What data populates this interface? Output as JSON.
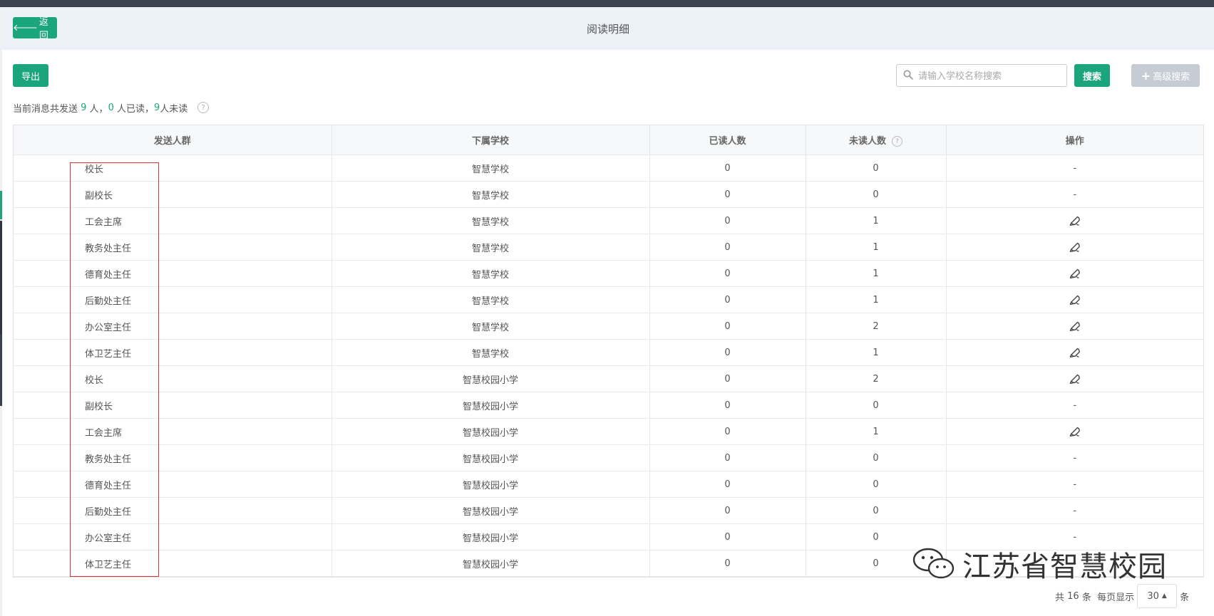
{
  "header": {
    "back_label": "返回",
    "title": "阅读明细"
  },
  "toolbar": {
    "export_label": "导出",
    "search_placeholder": "请输入学校名称搜索",
    "search_label": "搜索",
    "advanced_label": "高级搜索"
  },
  "summary": {
    "p1": "当前消息共发送 ",
    "sent": "9",
    "p2": " 人，",
    "read": "0",
    "p3": " 人已读，",
    "unread": "9",
    "p4": "人未读"
  },
  "table": {
    "headers": [
      "发送人群",
      "下属学校",
      "已读人数",
      "未读人数",
      "操作"
    ],
    "rows": [
      {
        "group": "校长",
        "school": "智慧学校",
        "read": "0",
        "unread": "0",
        "action": "-"
      },
      {
        "group": "副校长",
        "school": "智慧学校",
        "read": "0",
        "unread": "0",
        "action": "-"
      },
      {
        "group": "工会主席",
        "school": "智慧学校",
        "read": "0",
        "unread": "1",
        "action": "bell-icon"
      },
      {
        "group": "教务处主任",
        "school": "智慧学校",
        "read": "0",
        "unread": "1",
        "action": "bell-icon"
      },
      {
        "group": "德育处主任",
        "school": "智慧学校",
        "read": "0",
        "unread": "1",
        "action": "bell-icon"
      },
      {
        "group": "后勤处主任",
        "school": "智慧学校",
        "read": "0",
        "unread": "1",
        "action": "bell-icon"
      },
      {
        "group": "办公室主任",
        "school": "智慧学校",
        "read": "0",
        "unread": "2",
        "action": "bell-icon"
      },
      {
        "group": "体卫艺主任",
        "school": "智慧学校",
        "read": "0",
        "unread": "1",
        "action": "bell-icon"
      },
      {
        "group": "校长",
        "school": "智慧校园小学",
        "read": "0",
        "unread": "2",
        "action": "bell-icon"
      },
      {
        "group": "副校长",
        "school": "智慧校园小学",
        "read": "0",
        "unread": "0",
        "action": "-"
      },
      {
        "group": "工会主席",
        "school": "智慧校园小学",
        "read": "0",
        "unread": "1",
        "action": "bell-icon"
      },
      {
        "group": "教务处主任",
        "school": "智慧校园小学",
        "read": "0",
        "unread": "0",
        "action": "-"
      },
      {
        "group": "德育处主任",
        "school": "智慧校园小学",
        "read": "0",
        "unread": "0",
        "action": "-"
      },
      {
        "group": "后勤处主任",
        "school": "智慧校园小学",
        "read": "0",
        "unread": "0",
        "action": "-"
      },
      {
        "group": "办公室主任",
        "school": "智慧校园小学",
        "read": "0",
        "unread": "0",
        "action": "-"
      },
      {
        "group": "体卫艺主任",
        "school": "智慧校园小学",
        "read": "0",
        "unread": "0",
        "action": "-"
      }
    ]
  },
  "pagination": {
    "total_prefix": "共 ",
    "total": "16",
    "total_suffix": " 条  每页显示",
    "page_size": "30",
    "unit": "条"
  },
  "watermark": {
    "text": "江苏省智慧校园"
  },
  "colors": {
    "accent": "#1aa57c",
    "header_bg": "#ebf1f7",
    "disabled": "#c5ccd3",
    "highlight": "#dd3333"
  }
}
